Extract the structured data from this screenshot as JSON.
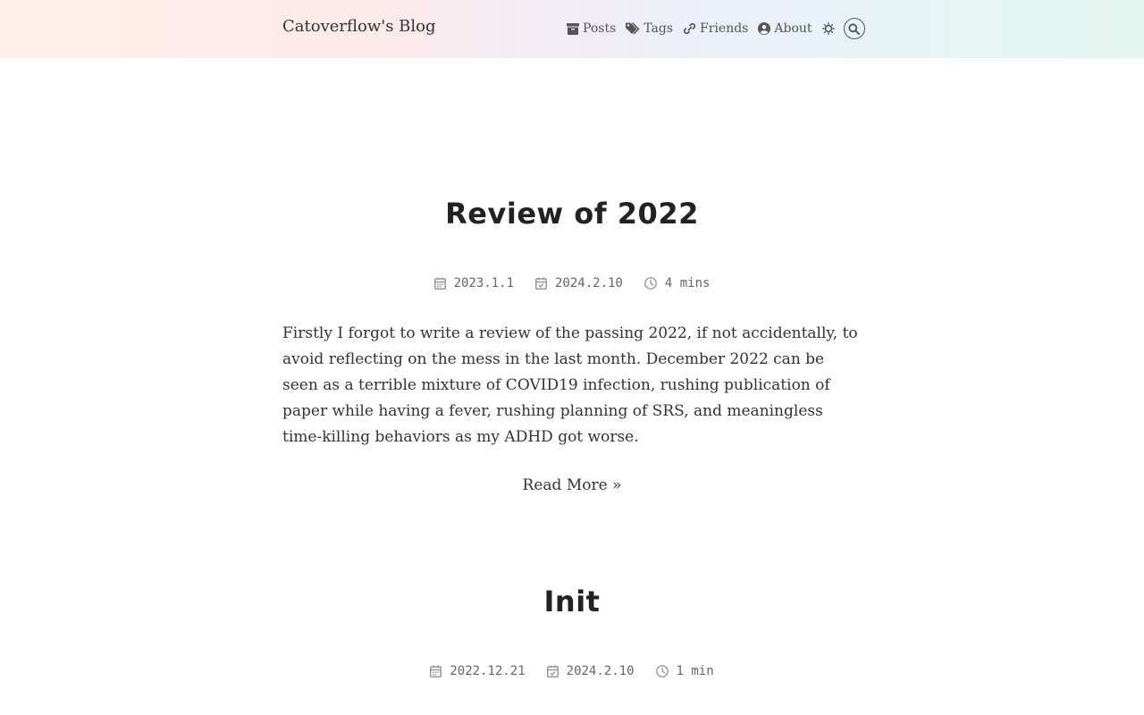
{
  "header": {
    "site_title": "Catoverflow's Blog",
    "nav": {
      "posts": "Posts",
      "tags": "Tags",
      "friends": "Friends",
      "about": "About"
    }
  },
  "posts": [
    {
      "title": "Review of 2022",
      "published": "2023.1.1",
      "updated": "2024.2.10",
      "reading_time": "4 mins",
      "excerpt": "Firstly I forgot to write a review of the passing 2022, if not accidentally, to avoid reflecting on the mess in the last month. December 2022 can be seen as a terrible mixture of COVID19 infection, rushing publication of paper while having a fever, rushing planning of SRS, and meaningless time-killing behaviors as my ADHD got worse.",
      "read_more": "Read More »"
    },
    {
      "title": "Init",
      "published": "2022.12.21",
      "updated": "2024.2.10",
      "reading_time": "1 min"
    }
  ]
}
